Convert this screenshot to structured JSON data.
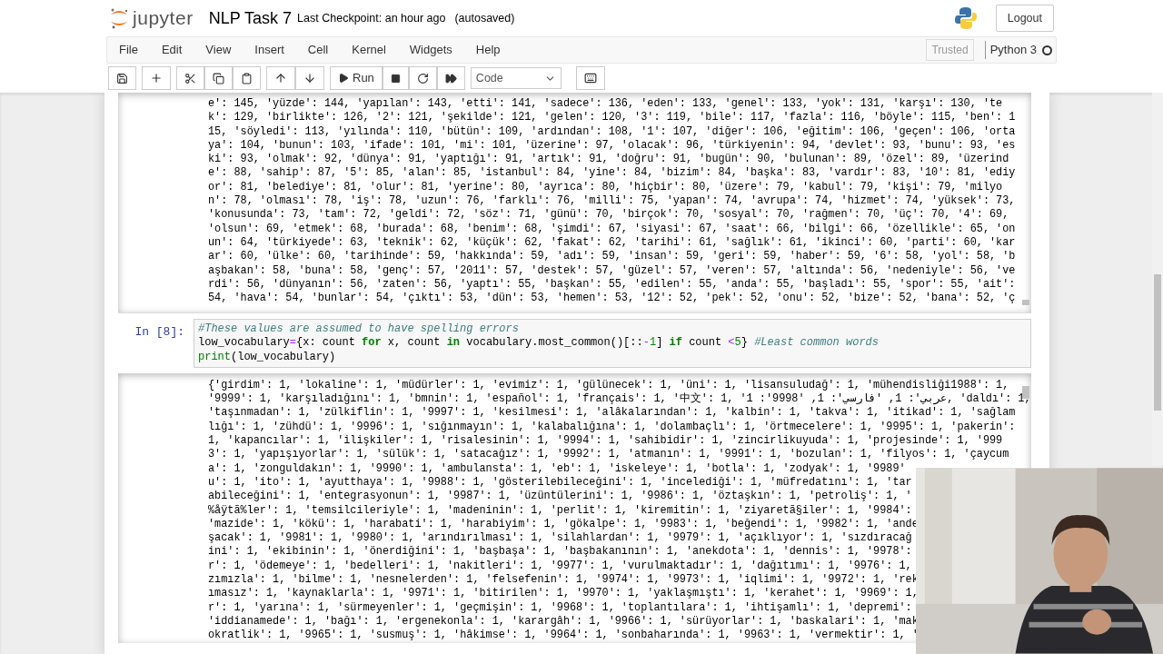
{
  "header": {
    "logo_text": "jupyter",
    "notebook_name": "NLP Task 7",
    "checkpoint": "Last Checkpoint: an hour ago",
    "autosave": "(autosaved)",
    "logout": "Logout"
  },
  "menu": [
    "File",
    "Edit",
    "View",
    "Insert",
    "Cell",
    "Kernel",
    "Widgets",
    "Help"
  ],
  "trusted": "Trusted",
  "kernel": {
    "name": "Python 3",
    "busy": false
  },
  "toolbar": {
    "run_label": "Run",
    "cell_type": "Code"
  },
  "cells": [
    {
      "kind": "output",
      "lines": [
        "e': 145, 'yüzde': 144, 'yapılan': 143, 'etti': 141, 'sadece': 136, 'eden': 133, 'genel': 133, 'yok': 131, 'karşı': 130, 'te",
        "k': 129, 'birlikte': 126, '2': 121, 'şekilde': 121, 'gelen': 120, '3': 119, 'bile': 117, 'fazla': 116, 'böyle': 115, 'ben': 1",
        "15, 'söyledi': 113, 'yılında': 110, 'bütün': 109, 'ardından': 108, '1': 107, 'diğer': 106, 'eğitim': 106, 'geçen': 106, 'orta",
        "ya': 104, 'bunun': 103, 'ifade': 101, 'mi': 101, 'üzerine': 97, 'olacak': 96, 'türkiyenin': 94, 'devlet': 93, 'bunu': 93, 'es",
        "ki': 93, 'olmak': 92, 'dünya': 91, 'yaptığı': 91, 'artık': 91, 'doğru': 91, 'bugün': 90, 'bulunan': 89, 'özel': 89, 'üzerind",
        "e': 88, 'sahip': 87, '5': 85, 'alan': 85, 'istanbul': 84, 'yine': 84, 'bizim': 84, 'başka': 83, 'vardır': 83, '10': 81, 'ediy",
        "or': 81, 'belediye': 81, 'olur': 81, 'yerine': 80, 'ayrıca': 80, 'hiçbir': 80, 'üzere': 79, 'kabul': 79, 'kişi': 79, 'milyo",
        "n': 78, 'olması': 78, 'iş': 78, 'uzun': 76, 'farklı': 76, 'milli': 75, 'yapan': 74, 'avrupa': 74, 'hizmet': 74, 'yüksek': 73,",
        "'konusunda': 73, 'tam': 72, 'geldi': 72, 'söz': 71, 'günü': 70, 'birçok': 70, 'sosyal': 70, 'rağmen': 70, 'üç': 70, '4': 69,",
        "'olsun': 69, 'etmek': 68, 'burada': 68, 'benim': 68, 'şimdi': 67, 'siyasi': 67, 'saat': 66, 'bilgi': 66, 'özellikle': 65, 'on",
        "un': 64, 'türkiyede': 63, 'teknik': 62, 'küçük': 62, 'fakat': 62, 'tarihi': 61, 'sağlık': 61, 'ikinci': 60, 'parti': 60, 'kar",
        "ar': 60, 'ülke': 60, 'tarihinde': 59, 'hakkında': 59, 'adı': 59, 'insan': 59, 'geri': 59, 'haber': 59, '6': 58, 'yol': 58, 'b",
        "aşbakan': 58, 'buna': 58, 'genç': 57, '2011': 57, 'destek': 57, 'güzel': 57, 'veren': 57, 'altında': 56, 'nedeniyle': 56, 've",
        "rdi': 56, 'dünyanın': 56, 'zaten': 56, 'yaptı': 55, 'başkan': 55, 'edilen': 55, 'anda': 55, 'başladı': 55, 'spor': 55, 'ait':",
        "54, 'hava': 54, 'bunlar': 54, 'çıktı': 53, 'dün': 53, 'hemen': 53, '12': 52, 'pek': 52, 'onu': 52, 'bize': 52, 'bana': 52, 'ç"
      ]
    },
    {
      "kind": "code",
      "prompt": "In [8]:",
      "lines": [
        [
          {
            "kind": "comment",
            "text": "#These values are assumed to have spelling errors"
          }
        ],
        [
          {
            "kind": "plain",
            "text": "low_vocabulary"
          },
          {
            "kind": "operator",
            "text": "="
          },
          {
            "kind": "plain",
            "text": "{x: count "
          },
          {
            "kind": "keyword",
            "text": "for"
          },
          {
            "kind": "plain",
            "text": " x, count "
          },
          {
            "kind": "keyword",
            "text": "in"
          },
          {
            "kind": "plain",
            "text": " vocabulary.most_common()[::"
          },
          {
            "kind": "operator",
            "text": "-"
          },
          {
            "kind": "number",
            "text": "1"
          },
          {
            "kind": "plain",
            "text": "] "
          },
          {
            "kind": "keyword",
            "text": "if"
          },
          {
            "kind": "plain",
            "text": " count "
          },
          {
            "kind": "operator",
            "text": "<"
          },
          {
            "kind": "number",
            "text": "5"
          },
          {
            "kind": "plain",
            "text": "} "
          },
          {
            "kind": "comment",
            "text": "#Least common words"
          }
        ],
        [
          {
            "kind": "builtin",
            "text": "print"
          },
          {
            "kind": "plain",
            "text": "(low_vocabulary)"
          }
        ]
      ]
    },
    {
      "kind": "output",
      "lines": [
        "{'girdim': 1, 'lokaline': 1, 'müdürler': 1, 'evimiz': 1, 'gülünecek': 1, 'üni': 1, 'lisansuludağ': 1, 'mühendisliği1988': 1,",
        "'9999': 1, 'karşıladığını': 1, 'bmnin': 1, 'español': 1, 'français': 1, '中文': 1, 'عربي': 1, 'فارسي': 1, '9998': 1, 'daldı': 1,",
        "'taşınmadan': 1, 'zülkiflin': 1, '9997': 1, 'kesilmesi': 1, 'alâkalarından': 1, 'kalbin': 1, 'takva': 1, 'itikad': 1, 'sağlam",
        "lığı': 1, 'zühdü': 1, '9996': 1, 'sığınmayın': 1, 'kalabalığına': 1, 'dolambaçlı': 1, 'örtmecelere': 1, '9995': 1, 'pakerin':",
        "1, 'kapancılar': 1, 'ilişkiler': 1, 'risalesinin': 1, '9994': 1, 'sahibidir': 1, 'zincirlikuyuda': 1, 'projesinde': 1, '999",
        "3': 1, 'yapışıyorlar': 1, 'sülük': 1, 'satacağız': 1, '9992': 1, 'atmanın': 1, '9991': 1, 'bozulan': 1, 'filyos': 1, 'çaycum",
        "a': 1, 'zonguldakın': 1, '9990': 1, 'ambulansta': 1, 'eb': 1, 'iskeleye': 1, 'botla': 1, 'zodyak': 1, '9989'",
        "u': 1, 'ito': 1, 'ayutthaya': 1, '9988': 1, 'gösterilebileceğini': 1, 'incelediği': 1, 'müfredatını': 1, 'tar",
        "abileceğini': 1, 'entegrasyonun': 1, '9987': 1, 'üzüntülerini': 1, '9986': 1, 'öztaşkın': 1, 'petroliş': 1, '",
        "%åÿtã%ler': 1, 'temsilcileriyle': 1, 'madeninin': 1, 'perlit': 1, 'kiremitin': 1, 'ziyaretã§iler': 1, '9984':",
        "'mazide': 1, 'kökü': 1, 'harabati': 1, 'harabiyim': 1, 'gökalpe': 1, '9983': 1, 'beğendi': 1, '9982': 1, 'ande",
        "şacak': 1, '9981': 1, '9980': 1, 'arındırılması': 1, 'silahlardan': 1, '9979': 1, 'açıklıyor': 1, 'sızdıracağ",
        "ini': 1, 'ekibinin': 1, 'önerdiğini': 1, 'başbaşa': 1, 'başbakanının': 1, 'anekdota': 1, 'dennis': 1, '9978':",
        "r': 1, 'ödemeye': 1, 'bedelleri': 1, 'nakitleri': 1, '9977': 1, 'vurulmaktadır': 1, 'dağıtımı': 1, '9976': 1,",
        "zımızla': 1, 'bilme': 1, 'nesnelerden': 1, 'felsefenin': 1, '9974': 1, '9973': 1, 'iqlimi': 1, '9972': 1, 'rek",
        "ımasız': 1, 'kaynaklarla': 1, '9971': 1, 'bitirilen': 1, '9970': 1, 'yaklaşmıştı': 1, 'kerahet': 1, '9969': 1,",
        "r': 1, 'yarına': 1, 'sürmeyenler': 1, 'geçmişin': 1, '9968': 1, 'toplantılara': 1, 'ihtişamlı': 1, 'depremi':",
        "'iddianamede': 1, 'bağı': 1, 'ergenekonla': 1, 'karargâh': 1, '9966': 1, 'sürüyorlar': 1, 'baskalari': 1, 'mak",
        "okratlik': 1, '9965': 1, 'susmuş': 1, 'hâkimse': 1, '9964': 1, 'sonbaharında': 1, '9963': 1, 'vermektir': 1, '"
      ]
    }
  ]
}
